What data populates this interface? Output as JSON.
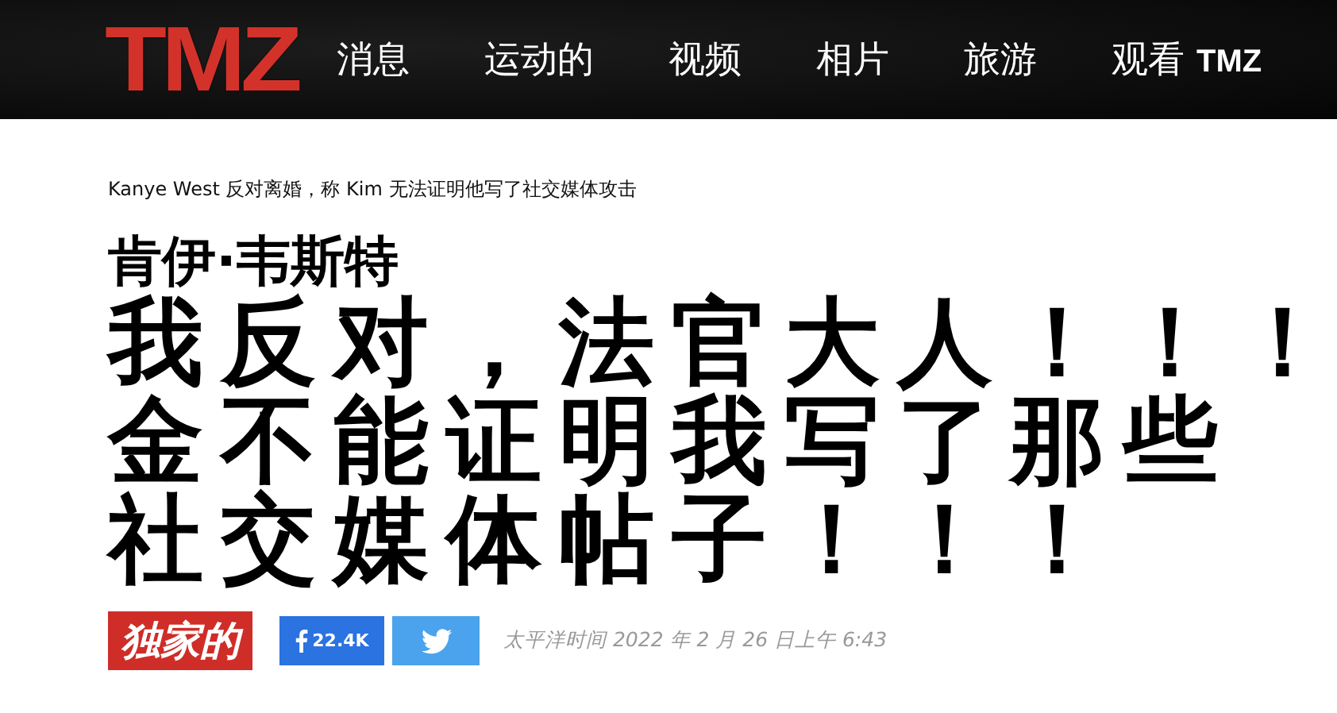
{
  "header": {
    "logo": "TMZ",
    "nav": [
      {
        "label": "消息"
      },
      {
        "label": "运动的"
      },
      {
        "label": "视频"
      },
      {
        "label": "相片"
      },
      {
        "label": "旅游"
      },
      {
        "label": "观看 **TMZ**"
      }
    ]
  },
  "article": {
    "breadcrumb": "Kanye West 反对离婚，称 Kim 无法证明他写了社交媒体攻击",
    "kicker": "肯伊·韦斯特",
    "headline_lines": [
      "我反对，法官大人！！！",
      "金不能证明我写了那些",
      "社交媒体帖子！！！"
    ],
    "badge": "独家的",
    "share": [
      {
        "kind": "facebook",
        "count": "22.4K"
      },
      {
        "kind": "twitter"
      }
    ],
    "timestamp": "太平洋时间 2022 年 2 月 26 日上午 6:43"
  }
}
